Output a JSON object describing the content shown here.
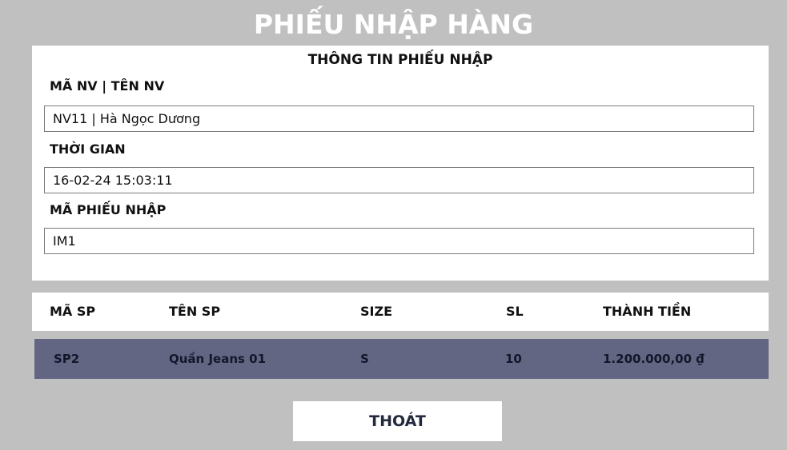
{
  "window": {
    "title": "PHIẾU NHẬP HÀNG"
  },
  "info": {
    "title": "THÔNG TIN PHIẾU NHẬP",
    "employee_label": "MÃ NV | TÊN NV",
    "employee_value": "NV11 | Hà Ngọc Dương",
    "time_label": "THỜI GIAN",
    "time_value": "16-02-24 15:03:11",
    "receipt_label": "MÃ PHIẾU NHẬP",
    "receipt_value": "IM1"
  },
  "table": {
    "headers": [
      "MÃ SP",
      "TÊN SP",
      "SIZE",
      "SL",
      "THÀNH TIỀN"
    ],
    "rows": [
      [
        "SP2",
        "Quần Jeans 01",
        "S",
        "10",
        "1.200.000,00 ₫"
      ]
    ]
  },
  "actions": {
    "exit_label": "THOÁT"
  },
  "colors": {
    "background": "#c0c0c0",
    "panel": "#ffffff",
    "row_background": "#626683",
    "title_text": "#ffffff"
  }
}
